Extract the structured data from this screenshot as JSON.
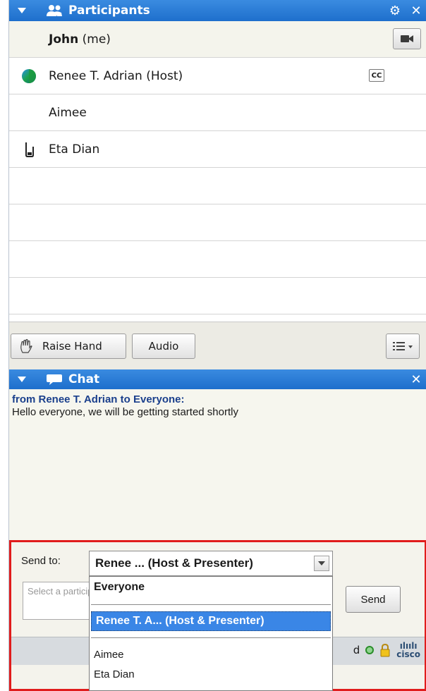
{
  "participants": {
    "header_title": "Participants",
    "rows": [
      {
        "name": "John",
        "suffix": " (me)"
      },
      {
        "name": "Renee T. Adrian (Host)",
        "badge": "CC"
      },
      {
        "name": "Aimee"
      },
      {
        "name": "Eta Dian"
      }
    ],
    "raise_hand_label": "Raise Hand",
    "audio_label": "Audio"
  },
  "chat": {
    "header_title": "Chat",
    "from_line": "from Renee T. Adrian to Everyone:",
    "message": "Hello everyone, we will be getting started shortly",
    "send_to_label": "Send to:",
    "selected_recipient": "Renee ...  (Host & Presenter)",
    "input_placeholder": "Select a participant and enter chat message",
    "send_label": "Send",
    "dropdown": {
      "everyone": "Everyone",
      "selected": "Renee T. A... (Host & Presenter)",
      "others": [
        "Aimee",
        "Eta Dian"
      ]
    },
    "status_text": "d",
    "cisco_logo_top": "ılıılı",
    "cisco_logo_bottom": "cisco"
  },
  "colors": {
    "header_blue": "#1e6fcc",
    "highlight_border": "#e01c1c",
    "selected_item": "#3a86e6"
  }
}
